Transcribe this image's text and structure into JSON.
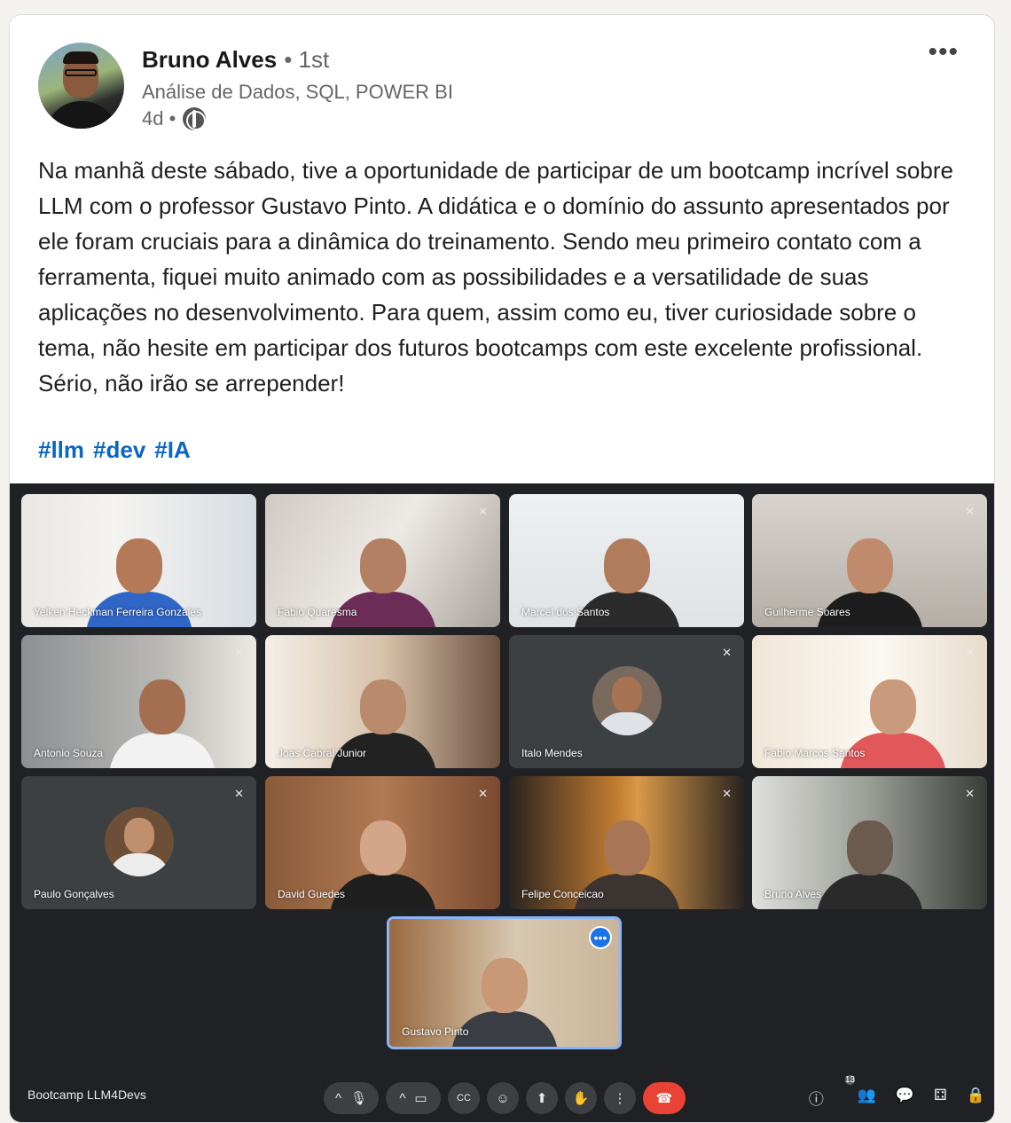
{
  "post": {
    "author": "Bruno Alves",
    "degree": "• 1st",
    "headline": "Análise de Dados, SQL, POWER BI",
    "time": "4d •",
    "more": "•••",
    "text": "Na manhã deste sábado, tive a oportunidade de participar de um bootcamp incrível sobre LLM com o professor Gustavo Pinto. A didática e o domínio do assunto apresentados por ele foram cruciais para a dinâmica do treinamento. Sendo meu primeiro contato com a ferramenta, fiquei muito animado com as possibilidades e a versatilidade de suas aplicações no desenvolvimento. Para quem, assim como eu, tiver curiosidade sobre o tema, não hesite em participar dos futuros bootcamps com este excelente profissional. Sério, não irão se arrepender!",
    "hashtags": [
      "#llm",
      "#dev",
      "#IA"
    ]
  },
  "meeting": {
    "name": "Bootcamp LLM4Devs",
    "participants_count": "13",
    "mic_off_icon": "✕",
    "tiles": [
      {
        "name": "Yelken Heckman Ferreira Gonzales"
      },
      {
        "name": "Fabio Quaresma"
      },
      {
        "name": "Marcel dos Santos"
      },
      {
        "name": "Guilherme Soares"
      },
      {
        "name": "Antonio Souza"
      },
      {
        "name": "Joas Cabral Junior"
      },
      {
        "name": "Italo Mendes"
      },
      {
        "name": "Fabio Marcos Santos"
      },
      {
        "name": "Paulo Gonçalves"
      },
      {
        "name": "David Guedes"
      },
      {
        "name": "Felipe Conceicao"
      },
      {
        "name": "Bruno Alves"
      },
      {
        "name": "Gustavo Pinto"
      }
    ],
    "controls": {
      "chevron": "^",
      "mic": "🎙",
      "camera": "▭",
      "captions": "CC",
      "emoji": "☺",
      "present": "⬆",
      "hand": "✋",
      "more": "⋮",
      "hangup": "☎",
      "info": "ⓘ",
      "people": "👥",
      "chat": "💬",
      "activities": "⚃",
      "lock": "🔒"
    },
    "colors": {
      "background": "#202124",
      "hangup": "#ea4335",
      "focus_border": "#8ab4f8"
    }
  },
  "colors": {
    "hashtag": "#0a66c2"
  }
}
